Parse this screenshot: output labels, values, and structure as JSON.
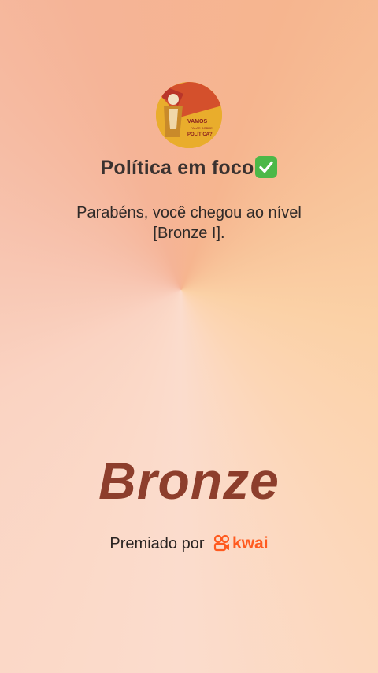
{
  "profile": {
    "avatar_text": [
      "VAMOS",
      "FALAR SOBRE",
      "POLÍTICA?"
    ]
  },
  "title": "Política em foco",
  "title_emoji": "check-mark-button-icon",
  "message": "Parabéns, você chegou ao nível [Bronze I].",
  "level_name": "Bronze",
  "awarded": {
    "prefix": "Premiado por",
    "brand": "kwai",
    "brand_icon": "kwai-logo-icon",
    "brand_color": "#ff5a1f"
  },
  "colors": {
    "level_text": "#8d3e2c",
    "check_green": "#4cb848"
  }
}
